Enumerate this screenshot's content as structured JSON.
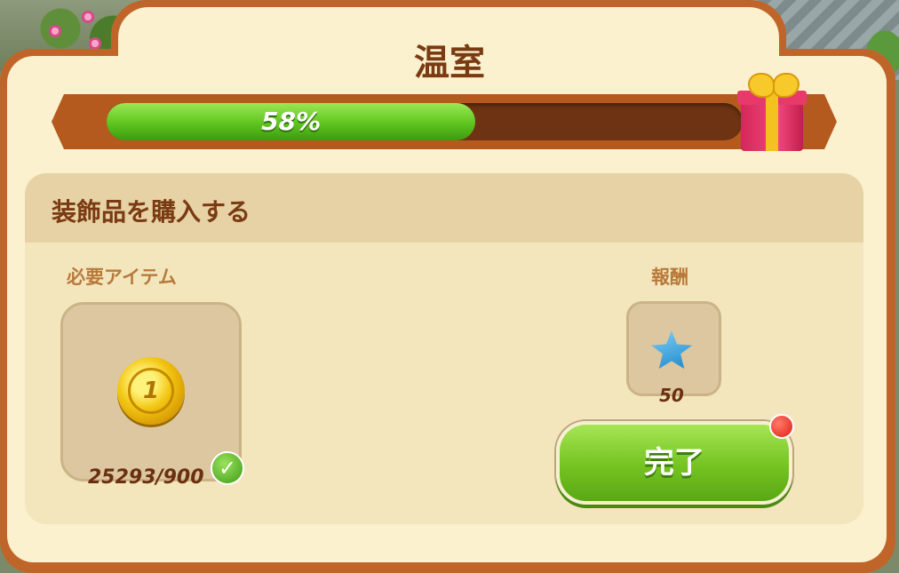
{
  "window": {
    "title": "温室"
  },
  "progress": {
    "percent": 58,
    "label": "58%"
  },
  "task": {
    "title": "装飾品を購入する",
    "required_label": "必要アイテム",
    "reward_label": "報酬",
    "required_item": {
      "icon": "gold-coin-icon",
      "coin_face": "1",
      "count": "25293/900",
      "complete": true
    },
    "reward_item": {
      "icon": "blue-star-icon",
      "count": "50"
    },
    "done_button": "完了"
  },
  "colors": {
    "frame": "#c0652a",
    "panel": "#fbf1cf",
    "title_text": "#7a3a12",
    "progress_fill": "#5ec41f",
    "button_green": "#74c321"
  }
}
